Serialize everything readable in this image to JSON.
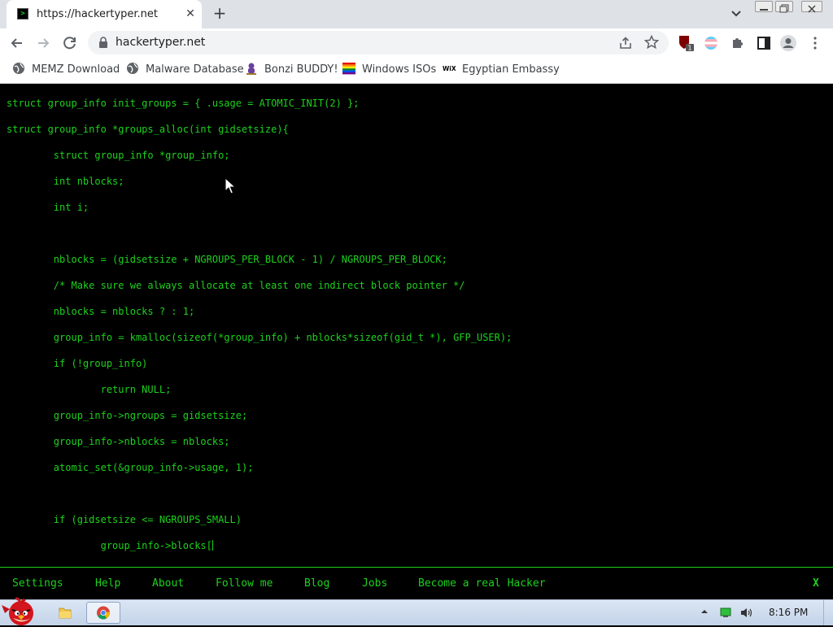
{
  "browser": {
    "tab": {
      "title": "https://hackertyper.net",
      "favicon": ">",
      "close": "✕"
    },
    "new_tab": "+",
    "address": {
      "url": "hackertyper.net"
    },
    "bookmarks": [
      {
        "label": "MEMZ Download",
        "icon": "globe-icon"
      },
      {
        "label": "Malware Database",
        "icon": "globe-icon"
      },
      {
        "label": "Bonzi BUDDY!",
        "icon": "bonzi-icon"
      },
      {
        "label": "Windows ISOs",
        "icon": "windows-flag-icon"
      },
      {
        "label": "Egyptian Embassy",
        "icon": "wix-icon"
      }
    ],
    "extension_badge": "1"
  },
  "code_lines": [
    "struct group_info init_groups = { .usage = ATOMIC_INIT(2) };",
    "struct group_info *groups_alloc(int gidsetsize){",
    "        struct group_info *group_info;",
    "        int nblocks;",
    "        int i;",
    "",
    "        nblocks = (gidsetsize + NGROUPS_PER_BLOCK - 1) / NGROUPS_PER_BLOCK;",
    "        /* Make sure we always allocate at least one indirect block pointer */",
    "        nblocks = nblocks ? : 1;",
    "        group_info = kmalloc(sizeof(*group_info) + nblocks*sizeof(gid_t *), GFP_USER);",
    "        if (!group_info)",
    "                return NULL;",
    "        group_info->ngroups = gidsetsize;",
    "        group_info->nblocks = nblocks;",
    "        atomic_set(&group_info->usage, 1);",
    "",
    "        if (gidsetsize <= NGROUPS_SMALL)",
    "                group_info->blocks["
  ],
  "menu": {
    "items": [
      "Settings",
      "Help",
      "About",
      "Follow me",
      "Blog",
      "Jobs",
      "Become a real Hacker"
    ],
    "close": "X"
  },
  "colors": {
    "terminal_green": "#1dd11d",
    "background": "#000000"
  },
  "taskbar": {
    "clock": "8:16 PM"
  }
}
